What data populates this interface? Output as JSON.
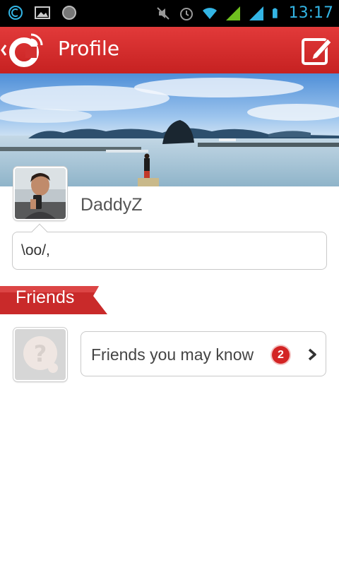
{
  "status_bar": {
    "time": "13:17",
    "icons": [
      "sync-icon",
      "image-icon",
      "record-icon",
      "mute-icon",
      "alarm-icon",
      "wifi-icon",
      "signal-icon",
      "signal-icon",
      "battery-icon"
    ]
  },
  "header": {
    "title": "Profile",
    "back_icon": "chevron-left-icon",
    "logo_icon": "app-logo-icon",
    "edit_icon": "edit-icon",
    "color": "#d32f2f"
  },
  "profile": {
    "username": "DaddyZ",
    "status_text": "\\oo/,"
  },
  "friends": {
    "section_label": "Friends",
    "suggest_label": "Friends you may know",
    "badge_count": "2"
  }
}
